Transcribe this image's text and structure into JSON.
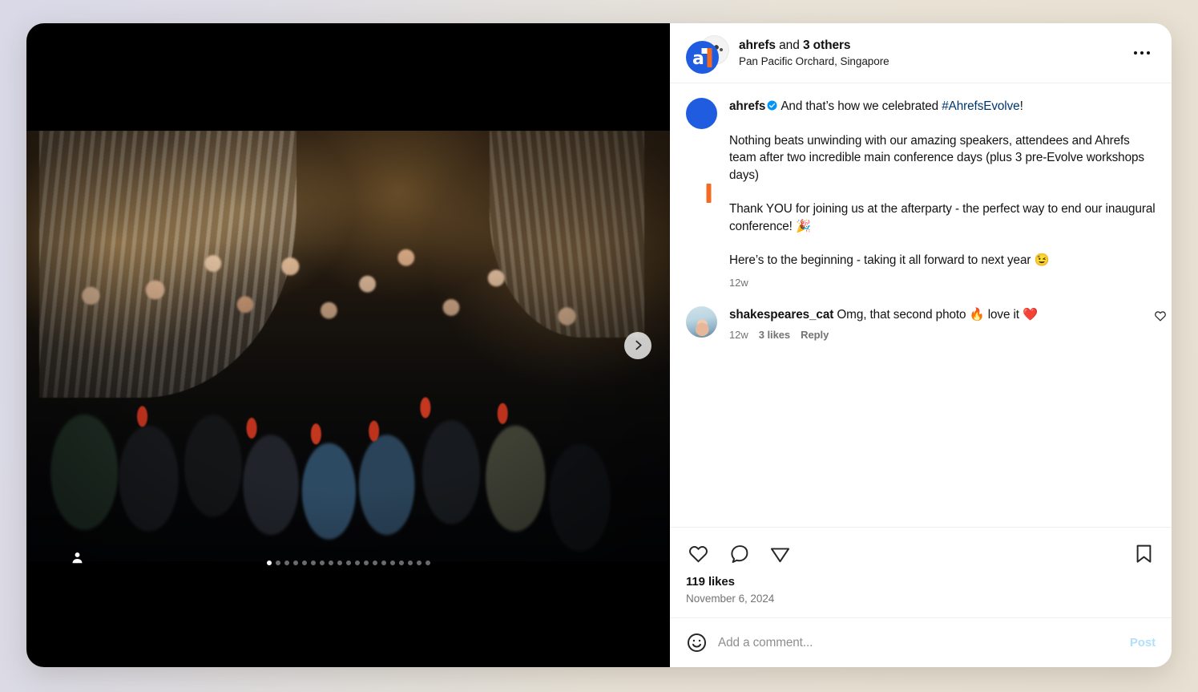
{
  "theme": {
    "accent_blue": "#0095f6",
    "link_blue": "#00376b",
    "post_disabled": "#b2dffc",
    "muted_text": "#737373",
    "brand_blue": "#1f5ce0",
    "brand_orange": "#f26b21",
    "card_background": "#ffffff",
    "media_background": "#000000",
    "page_background": "#dedce2"
  },
  "header": {
    "avatar_icon": "ahrefs-logo-avatar",
    "secondary_avatar_icon": "group-photo-avatar",
    "username": "ahrefs",
    "connector": "and",
    "others": "3 others",
    "location": "Pan Pacific Orchard, Singapore",
    "more_options_icon": "more-horizontal-icon"
  },
  "media": {
    "tag_icon": "person-tag-icon",
    "next_icon": "chevron-right-icon",
    "total_slides": 19,
    "active_slide": 1
  },
  "caption": {
    "avatar_icon": "ahrefs-logo-avatar",
    "username": "ahrefs",
    "verified_icon": "verified-badge-icon",
    "line1_before_hashtag": "And that’s how we celebrated ",
    "hashtag": "#AhrefsEvolve",
    "line1_after_hashtag": "!",
    "paragraph2": "Nothing beats unwinding with our amazing speakers, attendees and Ahrefs team after two incredible main conference days (plus 3 pre-Evolve workshops days)",
    "paragraph3": "Thank YOU for joining us at the afterparty - the perfect way to end our inaugural conference! 🎉",
    "paragraph4": "Here’s to the beginning - taking it all forward to next year 😉",
    "timestamp": "12w"
  },
  "comments": [
    {
      "avatar_icon": "user-photo-avatar",
      "username": "shakespeares_cat",
      "text": " Omg, that second photo 🔥  love it ❤️",
      "timestamp": "12w",
      "likes": "3 likes",
      "reply_label": "Reply",
      "like_icon": "heart-outline-icon"
    }
  ],
  "actions": {
    "like_icon": "heart-outline-icon",
    "comment_icon": "comment-bubble-icon",
    "share_icon": "share-paper-plane-icon",
    "save_icon": "bookmark-outline-icon",
    "likes_count": "119 likes",
    "post_date": "November 6, 2024"
  },
  "add_comment": {
    "emoji_icon": "emoji-smiley-icon",
    "value": "",
    "placeholder": "Add a comment...",
    "post_label": "Post"
  }
}
